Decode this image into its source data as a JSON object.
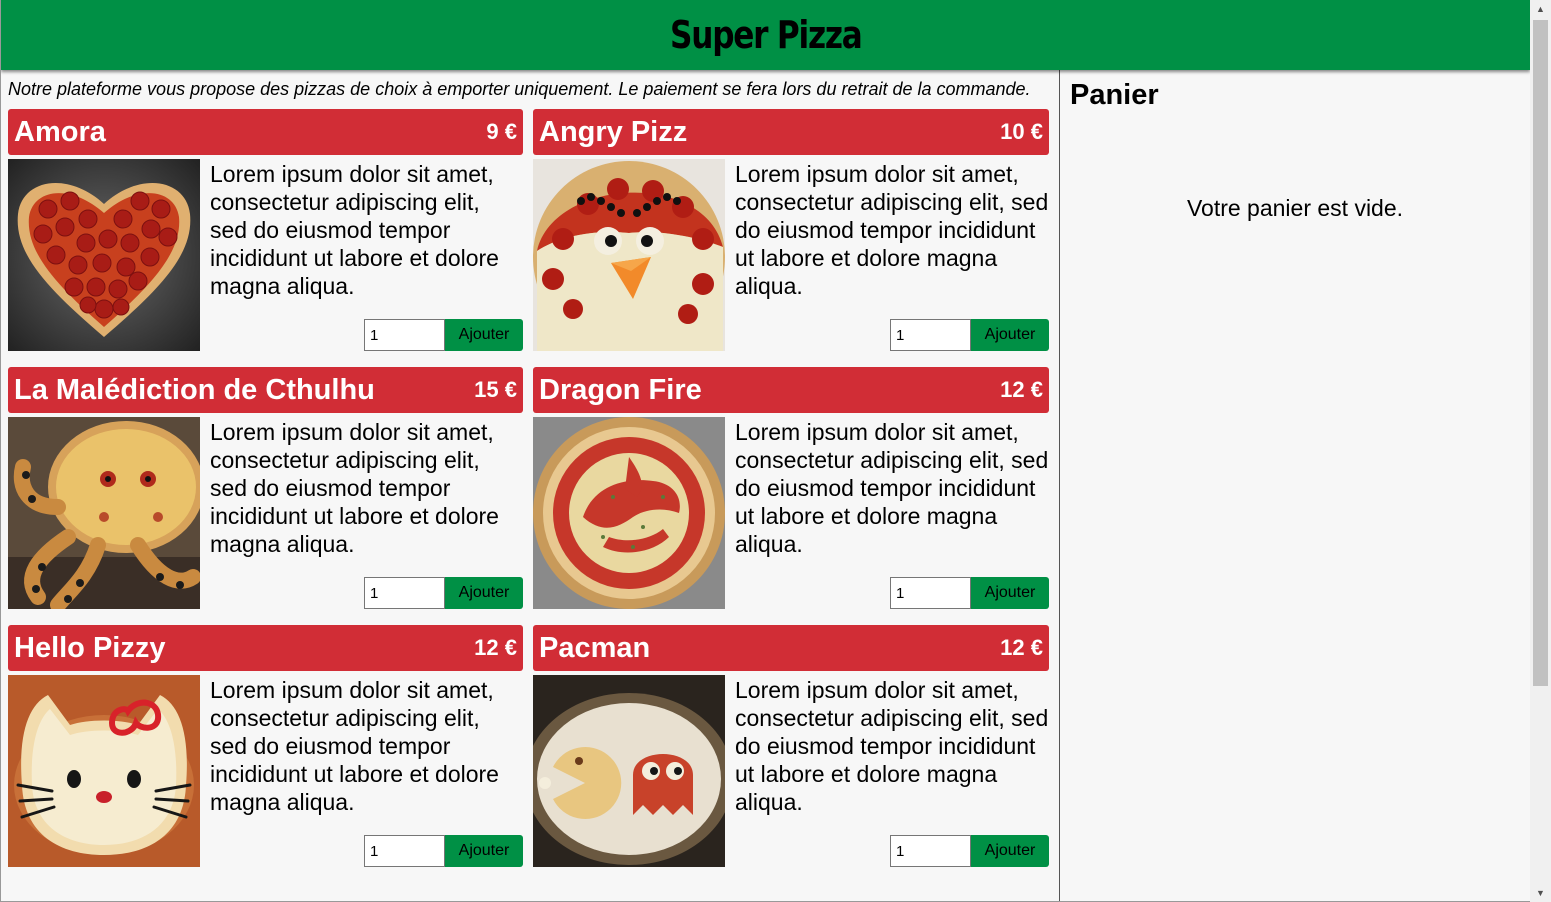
{
  "app": {
    "title": "Super Pizza",
    "intro": "Notre plateforme vous propose des pizzas de choix à emporter uniquement. Le paiement se fera lors du retrait de la commande."
  },
  "colors": {
    "header_green": "#009045",
    "card_red": "#d12d36",
    "button_green": "#009045"
  },
  "pizzas": [
    {
      "name": "Amora",
      "price": "9 €",
      "description": "Lorem ipsum dolor sit amet, consectetur adipiscing elit, sed do eiusmod tempor incididunt ut labore et dolore magna aliqua.",
      "quantity": "1",
      "button_label": "Ajouter"
    },
    {
      "name": "Angry Pizz",
      "price": "10 €",
      "description": "Lorem ipsum dolor sit amet, consectetur adipiscing elit, sed do eiusmod tempor incididunt ut labore et dolore magna aliqua.",
      "quantity": "1",
      "button_label": "Ajouter"
    },
    {
      "name": "La Malédiction de Cthulhu",
      "price": "15 €",
      "description": "Lorem ipsum dolor sit amet, consectetur adipiscing elit, sed do eiusmod tempor incididunt ut labore et dolore magna aliqua.",
      "quantity": "1",
      "button_label": "Ajouter"
    },
    {
      "name": "Dragon Fire",
      "price": "12 €",
      "description": "Lorem ipsum dolor sit amet, consectetur adipiscing elit, sed do eiusmod tempor incididunt ut labore et dolore magna aliqua.",
      "quantity": "1",
      "button_label": "Ajouter"
    },
    {
      "name": "Hello Pizzy",
      "price": "12 €",
      "description": "Lorem ipsum dolor sit amet, consectetur adipiscing elit, sed do eiusmod tempor incididunt ut labore et dolore magna aliqua.",
      "quantity": "1",
      "button_label": "Ajouter"
    },
    {
      "name": "Pacman",
      "price": "12 €",
      "description": "Lorem ipsum dolor sit amet, consectetur adipiscing elit, sed do eiusmod tempor incididunt ut labore et dolore magna aliqua.",
      "quantity": "1",
      "button_label": "Ajouter"
    }
  ],
  "cart": {
    "title": "Panier",
    "empty_message": "Votre panier est vide."
  },
  "icons": {
    "scroll_up": "scroll-up-arrow-icon",
    "scroll_down": "scroll-down-arrow-icon"
  }
}
